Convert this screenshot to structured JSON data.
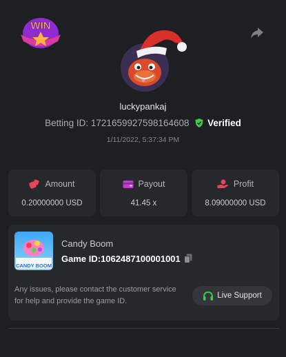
{
  "badge": {
    "text": "WIN"
  },
  "user": {
    "name": "luckypankaj",
    "betting_id_label": "Betting ID:",
    "betting_id": "1721659927598164608",
    "verified_label": "Verified",
    "datetime": "1/11/2022, 5:37:34 PM"
  },
  "stats": [
    {
      "icon": "dice-icon",
      "label": "Amount",
      "value": "0.20000000 USD",
      "color": "#e8455d"
    },
    {
      "icon": "wallet-icon",
      "label": "Payout",
      "value": "41.45 x",
      "color": "#c23ad6"
    },
    {
      "icon": "hand-coin-icon",
      "label": "Profit",
      "value": "8.09000000 USD",
      "color": "#e8455d"
    }
  ],
  "game": {
    "thumb_text": "CANDY BOOM",
    "name": "Candy Boom",
    "id_label": "Game ID:",
    "id": "1062487100001001"
  },
  "support": {
    "help_text": "Any issues, please contact the customer service for help and provide the game ID.",
    "button_label": "Live Support"
  },
  "colors": {
    "background": "#1e1f22",
    "card": "#27282c",
    "verified": "#3fc94c",
    "support_icon": "#3fc94c"
  }
}
